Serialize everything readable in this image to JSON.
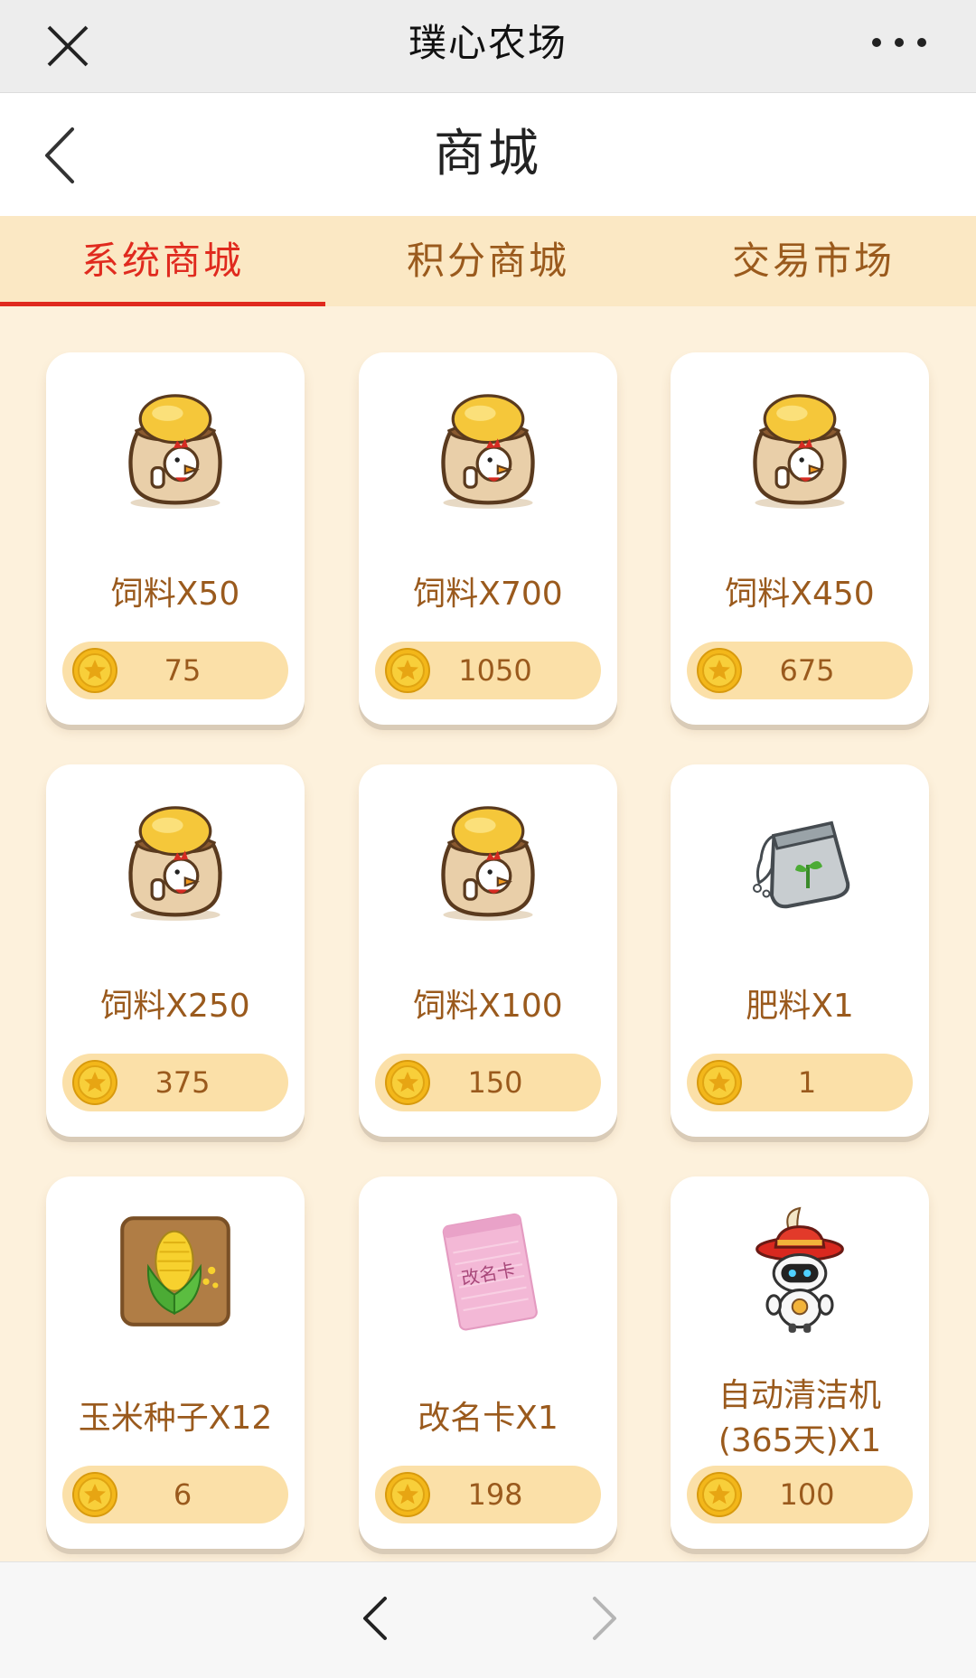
{
  "window": {
    "title": "璞心农场"
  },
  "header": {
    "title": "商城"
  },
  "tabs": [
    {
      "label": "系统商城",
      "active": true
    },
    {
      "label": "积分商城",
      "active": false
    },
    {
      "label": "交易市场",
      "active": false
    }
  ],
  "products": [
    {
      "name": "饲料X50",
      "price": "75",
      "icon": "feed-sack-icon"
    },
    {
      "name": "饲料X700",
      "price": "1050",
      "icon": "feed-sack-icon"
    },
    {
      "name": "饲料X450",
      "price": "675",
      "icon": "feed-sack-icon"
    },
    {
      "name": "饲料X250",
      "price": "375",
      "icon": "feed-sack-icon"
    },
    {
      "name": "饲料X100",
      "price": "150",
      "icon": "feed-sack-icon"
    },
    {
      "name": "肥料X1",
      "price": "1",
      "icon": "fertilizer-bag-icon"
    },
    {
      "name": "玉米种子X12",
      "price": "6",
      "icon": "corn-seed-icon"
    },
    {
      "name": "改名卡X1",
      "price": "198",
      "icon": "rename-card-icon",
      "card_text": "改名卡"
    },
    {
      "name": "自动清洁机(365天)X1",
      "price": "100",
      "icon": "cleaning-robot-icon"
    }
  ],
  "colors": {
    "accent": "#e02a1e",
    "text_brown": "#9a5a1d",
    "background": "#fdf1dc",
    "coin": "#f6c21c"
  },
  "icons": {
    "close": "close-icon",
    "more": "more-icon",
    "back": "back-icon",
    "coin": "coin-icon",
    "nav_back": "nav-back-icon",
    "nav_forward": "nav-forward-icon"
  }
}
